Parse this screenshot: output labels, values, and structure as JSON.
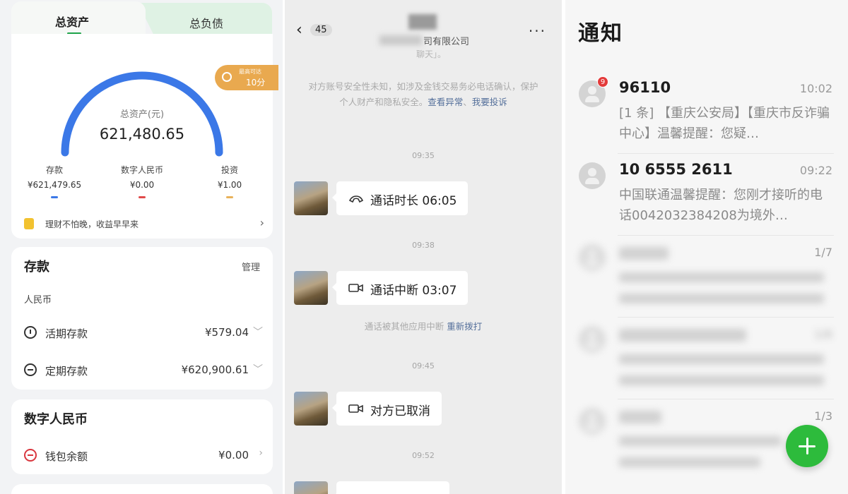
{
  "bank": {
    "tabs": {
      "total_assets": "总资产",
      "total_liabilities": "总负债"
    },
    "gauge": {
      "label": "总资产(元)",
      "value": "621,480.65"
    },
    "badge": {
      "line1": "最高可达",
      "line2": "10分"
    },
    "stats": [
      {
        "label": "存款",
        "value": "¥621,479.65",
        "color": "#3b78e7"
      },
      {
        "label": "数字人民币",
        "value": "¥0.00",
        "color": "#e04a4a"
      },
      {
        "label": "投资",
        "value": "¥1.00",
        "color": "#e9b25a"
      }
    ],
    "promo": {
      "text": "理财不怕晚，收益早早来",
      "arrow": "›"
    },
    "deposit": {
      "title": "存款",
      "manage": "管理",
      "currency": "人民币",
      "rows": [
        {
          "label": "活期存款",
          "value": "¥579.04",
          "icon": "clock-icon"
        },
        {
          "label": "定期存款",
          "value": "¥620,900.61",
          "icon": "fixed-deposit-icon"
        }
      ]
    },
    "digital": {
      "title": "数字人民币",
      "row": {
        "label": "钱包余额",
        "value": "¥0.00",
        "icon": "ecny-wallet-icon"
      }
    },
    "accent": "#1fa34a",
    "gauge_color": "#3b78e7"
  },
  "chat": {
    "back_count": "45",
    "title": "司有限公司",
    "more": "···",
    "prev_text": "聊天」。",
    "notice": "对方账号安全性未知，如涉及金钱交易务必电话确认，保护个人财产和隐私安全。",
    "notice_link1": "查看异常",
    "notice_link2": "我要投诉",
    "messages": [
      {
        "time": "09:35",
        "text": "通话时长 06:05",
        "icon": "phone-call-icon"
      },
      {
        "time": "09:38",
        "text": "通话中断 03:07",
        "icon": "video-call-icon"
      },
      {
        "time": "09:45",
        "text": "对方已取消",
        "icon": "video-call-icon"
      },
      {
        "time": "09:52",
        "text": "",
        "icon": "video-call-icon"
      }
    ],
    "interrupt_text": "通话被其他应用中断",
    "interrupt_link": "重新拨打"
  },
  "notifications": {
    "title": "通知",
    "items": [
      {
        "sender": "96110",
        "time": "10:02",
        "badge": "9",
        "preview": "[1 条] 【重庆公安局】【重庆市反诈骗中心】温馨提醒：您疑…"
      },
      {
        "sender": "10 6555 2611",
        "time": "09:22",
        "preview": "中国联通温馨提醒：您刚才接听的电话0042032384208为境外…"
      },
      {
        "time": "1/7"
      },
      {
        "time": "1/6"
      },
      {
        "time": "1/3"
      }
    ],
    "fab_color": "#2dbb3c"
  }
}
